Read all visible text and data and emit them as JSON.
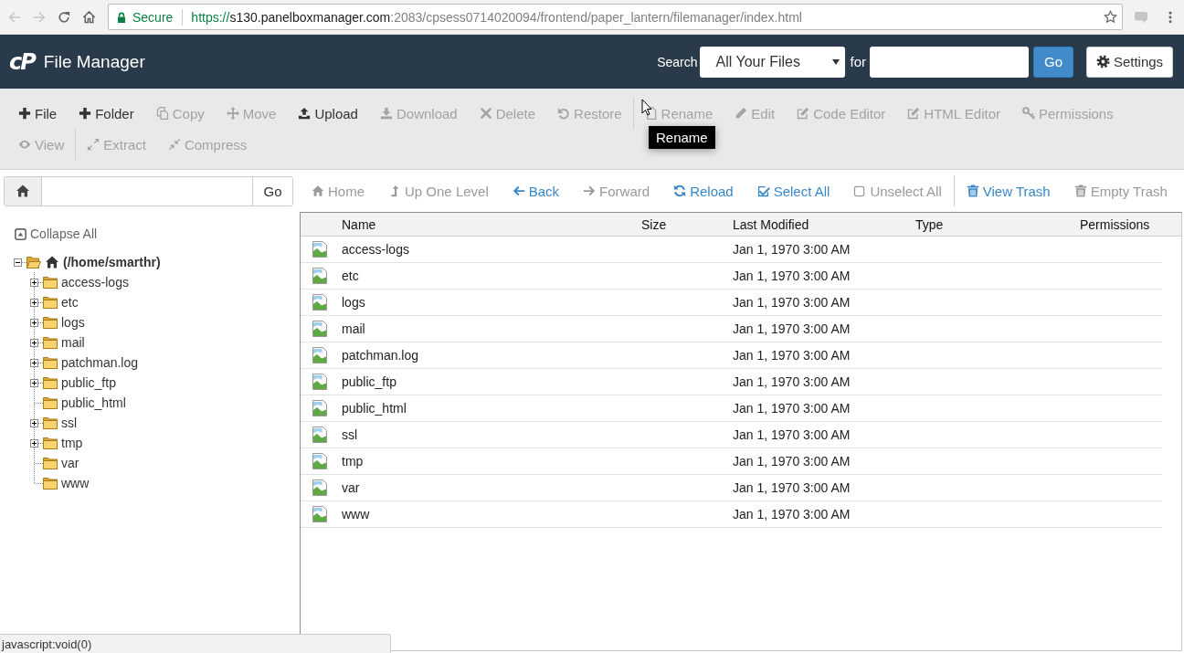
{
  "browser": {
    "back": {
      "disabled": true
    },
    "forward": {
      "disabled": true
    },
    "security": "Secure",
    "url": {
      "scheme": "https://",
      "host": "s130.panelboxmanager.com",
      "path": ":2083/cpsess0714020094/frontend/paper_lantern/filemanager/index.html"
    }
  },
  "header": {
    "logo": "cP",
    "title": "File Manager",
    "search_label": "Search",
    "scope": "All Your Files",
    "for_label": "for",
    "go": "Go",
    "settings": "Settings"
  },
  "toolbar": {
    "rows": [
      {
        "groups": [
          {
            "buttons": [
              {
                "label": "File",
                "disabled": false
              },
              {
                "label": "Folder",
                "disabled": false
              },
              {
                "label": "Copy",
                "disabled": true
              },
              {
                "label": "Move",
                "disabled": true
              },
              {
                "label": "Upload",
                "disabled": false
              },
              {
                "label": "Download",
                "disabled": true
              },
              {
                "label": "Delete",
                "disabled": true
              },
              {
                "label": "Restore",
                "disabled": true
              }
            ]
          },
          {
            "buttons": [
              {
                "label": "Rename",
                "disabled": true
              },
              {
                "label": "Edit",
                "disabled": true
              },
              {
                "label": "Code Editor",
                "disabled": true
              },
              {
                "label": "HTML Editor",
                "disabled": true
              },
              {
                "label": "Permissions",
                "disabled": true
              }
            ]
          }
        ]
      },
      {
        "groups": [
          {
            "buttons": [
              {
                "label": "View",
                "disabled": true
              }
            ]
          },
          {
            "buttons": [
              {
                "label": "Extract",
                "disabled": true
              },
              {
                "label": "Compress",
                "disabled": true
              }
            ]
          }
        ]
      }
    ],
    "tooltip": "Rename"
  },
  "path_bar": {
    "go": "Go"
  },
  "nav_links": {
    "groups": [
      {
        "links": [
          {
            "label": "Home",
            "disabled": true
          },
          {
            "label": "Up One Level",
            "disabled": true
          },
          {
            "label": "Back",
            "disabled": false
          },
          {
            "label": "Forward",
            "disabled": true
          },
          {
            "label": "Reload",
            "disabled": false
          },
          {
            "label": "Select All",
            "disabled": false
          },
          {
            "label": "Unselect All",
            "disabled": true
          }
        ]
      },
      {
        "links": [
          {
            "label": "View Trash",
            "disabled": false
          },
          {
            "label": "Empty Trash",
            "disabled": true
          }
        ]
      }
    ]
  },
  "sidebar": {
    "collapse_all": "Collapse All",
    "tree": {
      "label": "(/home/smarthr)",
      "expanded": true,
      "children": [
        {
          "label": "access-logs",
          "expanded": false
        },
        {
          "label": "etc",
          "expanded": false
        },
        {
          "label": "logs",
          "expanded": false
        },
        {
          "label": "mail",
          "expanded": false
        },
        {
          "label": "patchman.log",
          "expanded": false
        },
        {
          "label": "public_ftp",
          "expanded": false
        },
        {
          "label": "public_html"
        },
        {
          "label": "ssl",
          "expanded": false
        },
        {
          "label": "tmp",
          "expanded": false
        },
        {
          "label": "var"
        },
        {
          "label": "www"
        }
      ]
    }
  },
  "table": {
    "columns": [
      "Name",
      "Size",
      "Last Modified",
      "Type",
      "Permissions"
    ],
    "rows": [
      {
        "name": "access-logs",
        "last_modified": "Jan 1, 1970 3:00 AM"
      },
      {
        "name": "etc",
        "last_modified": "Jan 1, 1970 3:00 AM"
      },
      {
        "name": "logs",
        "last_modified": "Jan 1, 1970 3:00 AM"
      },
      {
        "name": "mail",
        "last_modified": "Jan 1, 1970 3:00 AM"
      },
      {
        "name": "patchman.log",
        "last_modified": "Jan 1, 1970 3:00 AM"
      },
      {
        "name": "public_ftp",
        "last_modified": "Jan 1, 1970 3:00 AM"
      },
      {
        "name": "public_html",
        "last_modified": "Jan 1, 1970 3:00 AM"
      },
      {
        "name": "ssl",
        "last_modified": "Jan 1, 1970 3:00 AM"
      },
      {
        "name": "tmp",
        "last_modified": "Jan 1, 1970 3:00 AM"
      },
      {
        "name": "var",
        "last_modified": "Jan 1, 1970 3:00 AM"
      },
      {
        "name": "www",
        "last_modified": "Jan 1, 1970 3:00 AM"
      }
    ]
  },
  "status_bar": {
    "text": "javascript:void(0)"
  }
}
